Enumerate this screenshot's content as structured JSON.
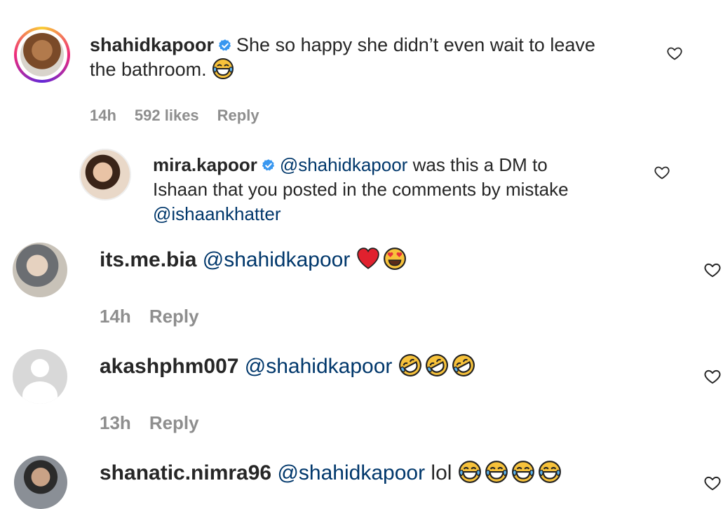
{
  "comments": [
    {
      "username": "shahidkapoor",
      "text_line1": "She so happy she didn’t even wait to leave",
      "text_line2": "the bathroom.",
      "time": "14h",
      "likes": "592 likes",
      "reply": "Reply"
    },
    {
      "username": "mira.kapoor",
      "mention": "@shahidkapoor",
      "text_line1": "was this a DM to",
      "text_line2": "Ishaan that you posted in the comments by mistake",
      "mention2": "@ishaankhatter"
    },
    {
      "username": "its.me.bia",
      "mention": "@shahidkapoor",
      "time": "14h",
      "reply": "Reply"
    },
    {
      "username": "akashphm007",
      "mention": "@shahidkapoor",
      "time": "13h",
      "reply": "Reply"
    },
    {
      "username": "shanatic.nimra96",
      "mention": "@shahidkapoor",
      "text": "lol"
    }
  ],
  "icons": {
    "verified": "verified-badge-icon",
    "like": "heart-outline-icon",
    "laughing": "face-with-tears-of-joy",
    "rolling": "rolling-on-floor-laughing",
    "heart_eyes": "smiling-face-with-heart-eyes",
    "red_heart": "red-heart"
  },
  "colors": {
    "username": "#262626",
    "mention": "#00376b",
    "meta": "#8e8e8e",
    "verified": "#3897f0"
  }
}
